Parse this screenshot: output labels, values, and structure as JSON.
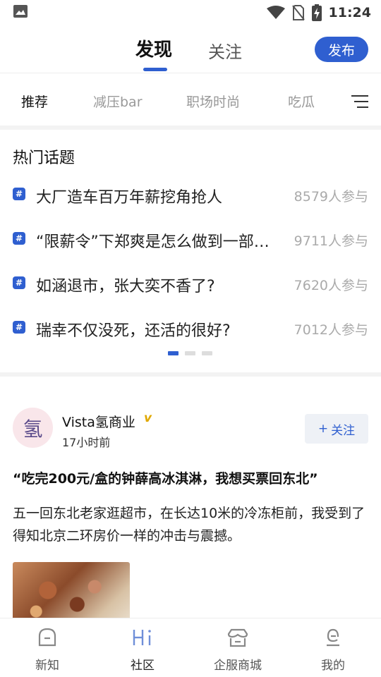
{
  "status_bar": {
    "time": "11:24",
    "icons": [
      "image-icon",
      "wifi-icon",
      "no-sim-icon",
      "battery-charging-icon"
    ]
  },
  "top_nav": {
    "tabs": [
      {
        "label": "发现",
        "active": true
      },
      {
        "label": "关注",
        "active": false
      }
    ],
    "publish_label": "发布"
  },
  "categories": [
    {
      "label": "推荐",
      "active": true
    },
    {
      "label": "减压bar",
      "active": false
    },
    {
      "label": "职场时尚",
      "active": false
    },
    {
      "label": "吃瓜",
      "active": false
    }
  ],
  "hot_topics": {
    "title": "热门话题",
    "hash_symbol": "#",
    "items": [
      {
        "text": "大厂造车百万年薪挖角抢人",
        "count": "8579人参与"
      },
      {
        "text": "“限薪令”下郑爽是怎么做到一部…",
        "count": "9711人参与"
      },
      {
        "text": "如涵退市，张大奕不香了?",
        "count": "7620人参与"
      },
      {
        "text": "瑞幸不仅没死，还活的很好?",
        "count": "7012人参与"
      }
    ],
    "page_count": 3,
    "active_page": 1
  },
  "post": {
    "avatar_char": "氢",
    "author": "Vista氢商业",
    "verified_mark": "v",
    "time": "17小时前",
    "follow_label": "关注",
    "follow_plus": "+",
    "title": "“吃完200元/盒的钟薛高冰淇淋，我想买票回东北”",
    "body": "五一回东北老家逛超市，在长达10米的冷冻柜前，我受到了得知北京二环房价一样的冲击与震撼。"
  },
  "bottom_nav": [
    {
      "label": "新知",
      "icon": "news-icon",
      "active": false
    },
    {
      "label": "社区",
      "icon": "hi-community-icon",
      "active": true
    },
    {
      "label": "企服商城",
      "icon": "shop-icon",
      "active": false
    },
    {
      "label": "我的",
      "icon": "profile-icon",
      "active": false
    }
  ],
  "colors": {
    "accent": "#2f5fd0",
    "verified": "#e0a800",
    "muted": "#aaaaaa"
  }
}
